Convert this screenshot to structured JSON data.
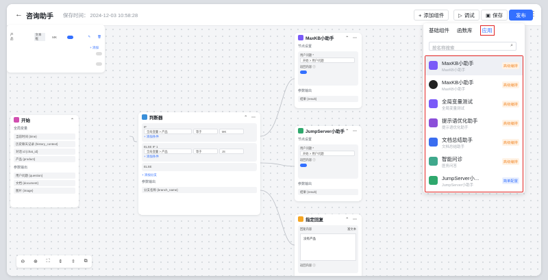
{
  "header": {
    "title": "咨询助手",
    "saved_label": "保存时间：",
    "saved_time": "2024-12-03 10:58:28",
    "add_component": "添加组件",
    "debug": "调试",
    "save": "保存",
    "publish": "发布"
  },
  "colors": {
    "accent": "#3370ff",
    "highlight_border": "#e0201f",
    "badge_orange": "#f38f35"
  },
  "top_left_card": {
    "label": "产品",
    "tag": "文本框",
    "field": "MK",
    "add": "+ 添加"
  },
  "start_node": {
    "title": "开始",
    "global_label": "全局变量",
    "globals": [
      "当前时间 {time}",
      "历史聊天记录 {history_context}",
      "对话 id {chat_id}",
      "产品 {product}"
    ],
    "params_label": "参数输出",
    "params": [
      "用户问题 {question}",
      "文档 {document}",
      "图片 {image}"
    ]
  },
  "judge_node": {
    "title": "判断器",
    "if_label": "IF",
    "if_field": "全局变量 > 产品",
    "if_op": "等于",
    "if_val": "MK",
    "add_cond": "+ 添加条件",
    "elseif_label": "ELSE IF 1",
    "elseif_field": "全局变量 > 产品",
    "elseif_op": "等于",
    "elseif_val": "JS",
    "add_cond2": "+ 添加条件",
    "else_label": "ELSE",
    "add_branch": "+ 添加分支",
    "params_label": "参数输出",
    "param": "分支名称 {branch_name}"
  },
  "maxkb_node": {
    "title": "MaxKB小助手",
    "settings": "节点设置",
    "input_label": "用户问题 *",
    "input_val": "开始 > 用户问题",
    "return_label": "返回内容 ⓘ",
    "params_label": "参数输出",
    "param": "结果 {result}"
  },
  "jump_node": {
    "title": "JumpServer小助手",
    "settings": "节点设置",
    "input_label": "用户问题 *",
    "input_val": "开始 > 用户问题",
    "return_label": "返回内容 ⓘ",
    "params_label": "参数输出",
    "param": "结果 {result}"
  },
  "reply_node": {
    "title": "指定回复",
    "content_label": "回复内容",
    "mode": "富文本",
    "content": "没有产品",
    "return_label": "返回内容 ⓘ"
  },
  "panel": {
    "tabs": [
      "基础组件",
      "函数库",
      "应用"
    ],
    "search_placeholder": "按名称搜索",
    "items": [
      {
        "name": "MaxKB小助手",
        "desc": "MaxKB小助手",
        "badge": "高级编排",
        "icon": "chat-icon",
        "color": "#7a5af8"
      },
      {
        "name": "MaxKB小助手",
        "desc": "MaxKB小助手",
        "badge": "高级编排",
        "icon": "avatar-icon",
        "color": "#222222"
      },
      {
        "name": "全局变量测试",
        "desc": "全局变量测试",
        "badge": "高级编排",
        "icon": "chat-icon",
        "color": "#7a5af8"
      },
      {
        "name": "提示语优化助手",
        "desc": "提示语优化助手",
        "badge": "高级编排",
        "icon": "hint-icon",
        "color": "#8b4fd9"
      },
      {
        "name": "文档总结助手",
        "desc": "文档总结助手",
        "badge": "高级编排",
        "icon": "doc-icon",
        "color": "#3a6df0"
      },
      {
        "name": "智能问诊",
        "desc": "医务问答",
        "badge": "高级编排",
        "icon": "med-icon",
        "color": "#3fa88c"
      },
      {
        "name": "JumpServer小...",
        "desc": "JumpServer小助手",
        "badge": "简单配置",
        "icon": "jumpserver-icon",
        "color": "#2fa86d"
      }
    ]
  }
}
